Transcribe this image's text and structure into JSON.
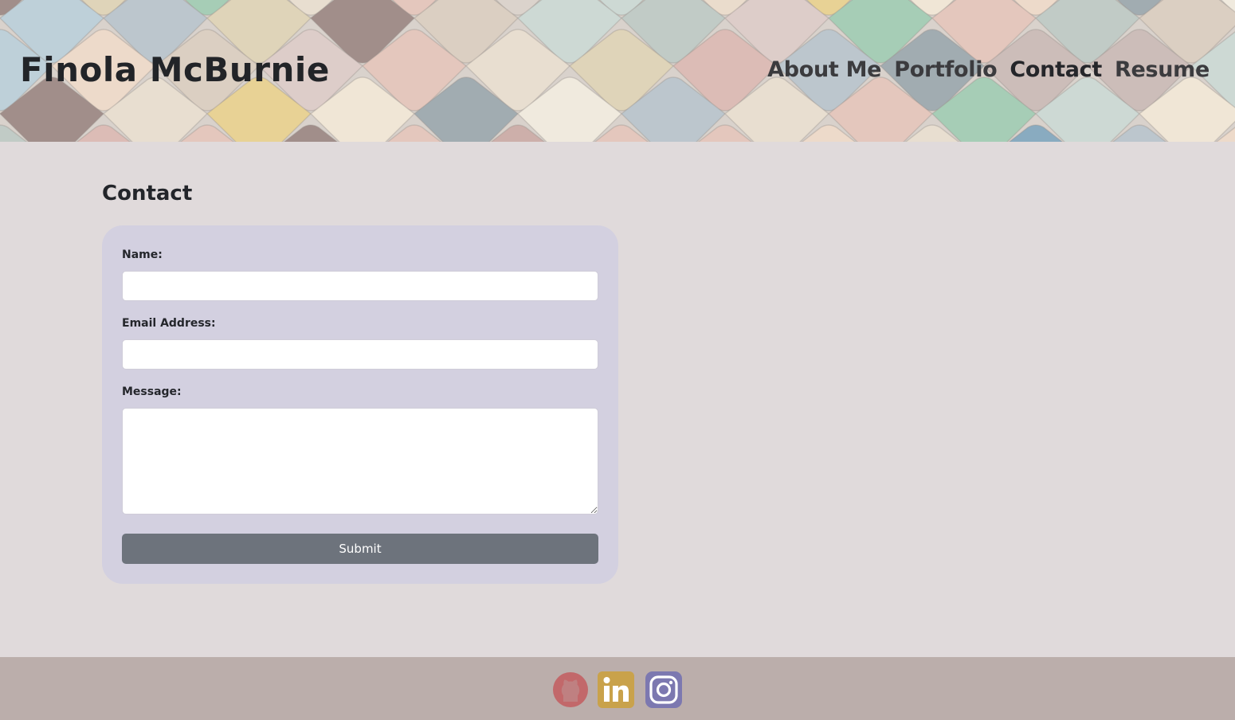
{
  "header": {
    "site_title": "Finola McBurnie",
    "nav": [
      {
        "label": "About Me"
      },
      {
        "label": "Portfolio"
      },
      {
        "label": "Contact"
      },
      {
        "label": "Resume"
      }
    ],
    "active_nav": "Contact"
  },
  "main": {
    "title": "Contact",
    "form": {
      "name_label": "Name:",
      "name_value": "",
      "email_label": "Email Address:",
      "email_value": "",
      "message_label": "Message:",
      "message_value": "",
      "submit_label": "Submit"
    }
  },
  "footer": {
    "social_links": [
      {
        "icon": "github-icon",
        "color": "#c2686a"
      },
      {
        "icon": "linkedin-icon",
        "color": "#c9a24b"
      },
      {
        "icon": "instagram-icon",
        "color": "#7c78b0"
      }
    ]
  },
  "colors": {
    "page_background": "#e0dadb",
    "form_background": "#d3d0e0",
    "submit_button": "#6d737c",
    "footer_background": "#bbaeab"
  }
}
